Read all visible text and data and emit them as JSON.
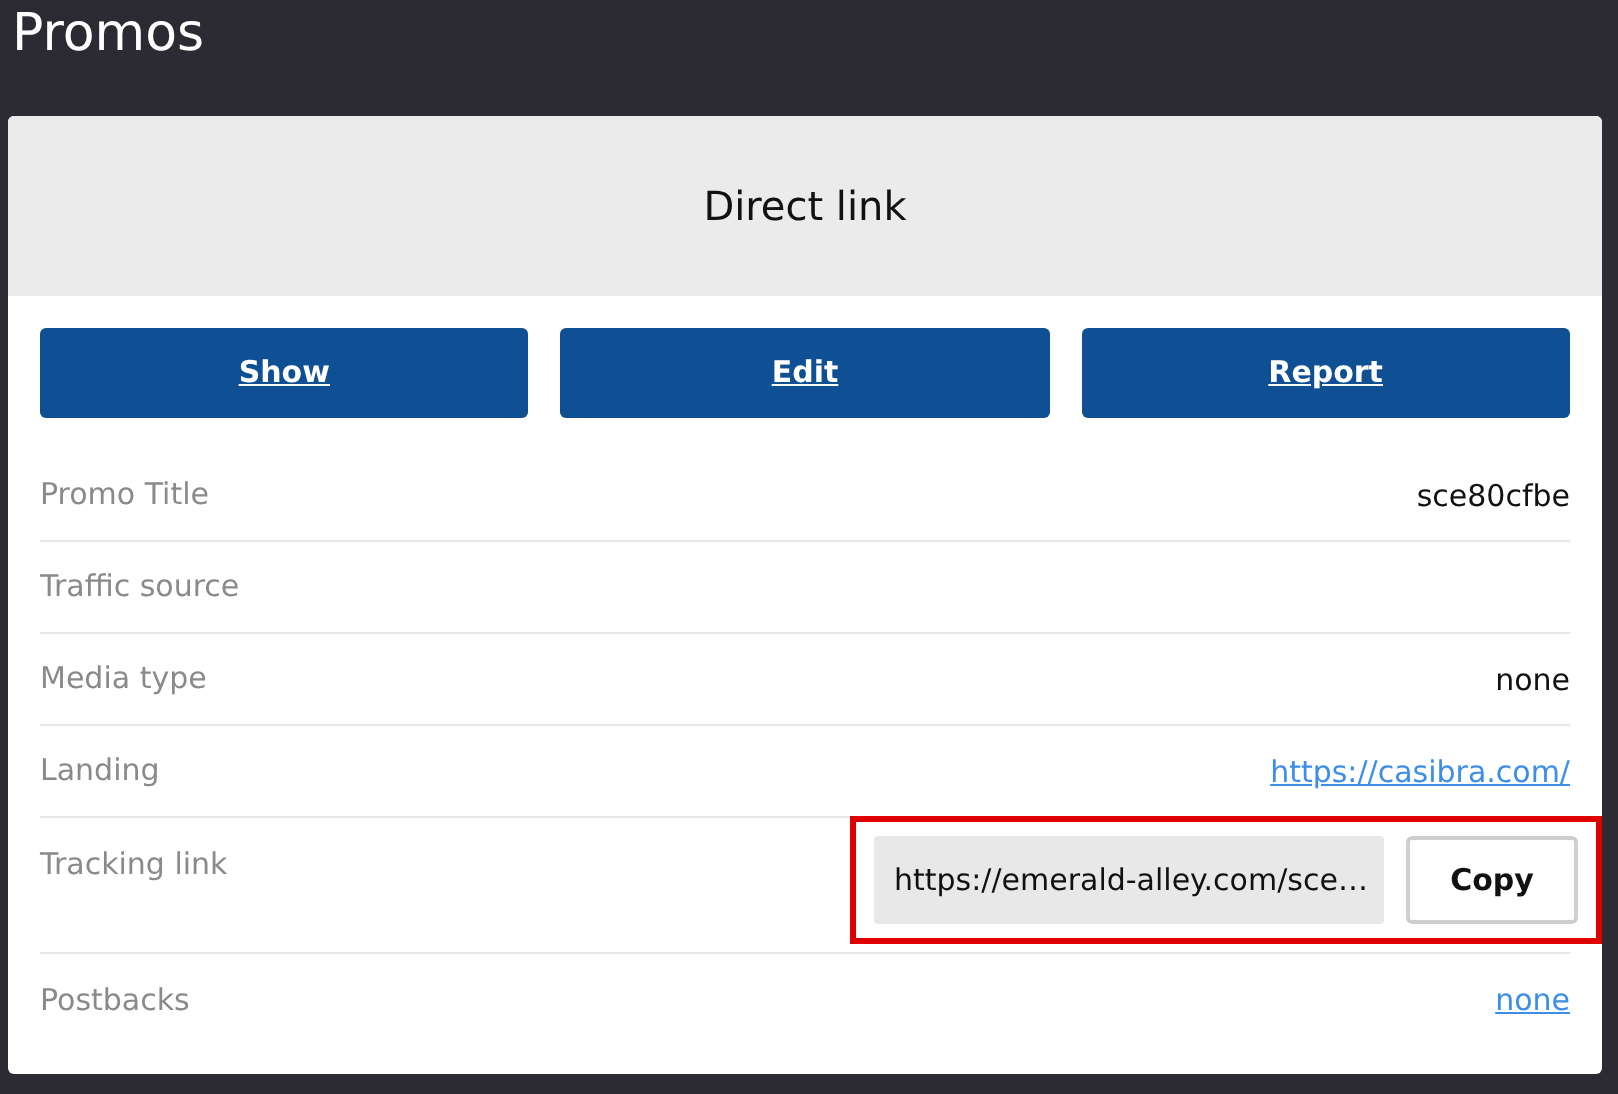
{
  "page_title": "Promos",
  "card": {
    "title": "Direct link",
    "buttons": [
      "Show",
      "Edit",
      "Report"
    ],
    "rows": [
      {
        "label": "Promo Title",
        "kind": "text",
        "value": "sce80cfbe"
      },
      {
        "label": "Traffic source",
        "kind": "empty"
      },
      {
        "label": "Media type",
        "kind": "text",
        "value": "none"
      },
      {
        "label": "Landing",
        "kind": "link",
        "value": "https://casibra.com/"
      },
      {
        "label": "Tracking link",
        "kind": "copy",
        "value": "https://emerald-alley.com/sce…",
        "button": "Copy"
      },
      {
        "label": "Postbacks",
        "kind": "link",
        "value": "none"
      }
    ]
  }
}
